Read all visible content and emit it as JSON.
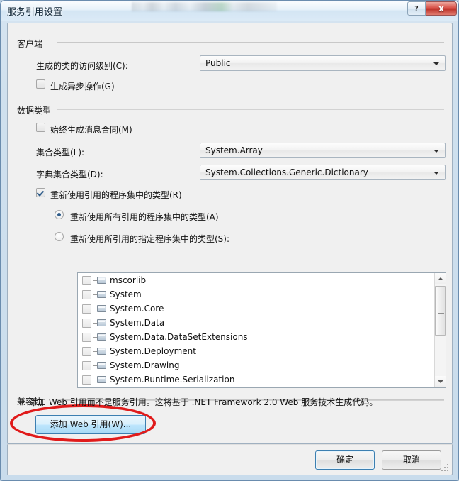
{
  "window": {
    "title": "服务引用设置",
    "help_button": "?",
    "close_button": "x"
  },
  "client_group": {
    "legend": "客户端",
    "access_level_label": "生成的类的访问级别(C):",
    "access_level_value": "Public",
    "async_checkbox_label": "生成异步操作(G)",
    "async_checked": false
  },
  "data_type_group": {
    "legend": "数据类型",
    "message_contract_label": "始终生成消息合同(M)",
    "message_contract_checked": false,
    "collection_type_label": "集合类型(L):",
    "collection_type_value": "System.Array",
    "dictionary_type_label": "字典集合类型(D):",
    "dictionary_type_value": "System.Collections.Generic.Dictionary",
    "reuse_checkbox_label": "重新使用引用的程序集中的类型(R)",
    "reuse_checked": true,
    "reuse_all_radio_label": "重新使用所有引用的程序集中的类型(A)",
    "reuse_all_selected": true,
    "reuse_specified_radio_label": "重新使用所引用的指定程序集中的类型(S):",
    "reuse_specified_selected": false,
    "assemblies": [
      {
        "name": "mscorlib",
        "checked": false
      },
      {
        "name": "System",
        "checked": false
      },
      {
        "name": "System.Core",
        "checked": false
      },
      {
        "name": "System.Data",
        "checked": false
      },
      {
        "name": "System.Data.DataSetExtensions",
        "checked": false
      },
      {
        "name": "System.Deployment",
        "checked": false
      },
      {
        "name": "System.Drawing",
        "checked": false
      },
      {
        "name": "System.Runtime.Serialization",
        "checked": false
      }
    ]
  },
  "compatibility_group": {
    "legend": "兼容性",
    "description": "添加 Web 引用而不是服务引用。这将基于 .NET Framework 2.0 Web 服务技术生成代码。",
    "add_web_reference_button": "添加 Web 引用(W)..."
  },
  "footer": {
    "ok_button": "确定",
    "cancel_button": "取消"
  },
  "colors": {
    "annotation_red": "#e01b1b",
    "accent_blue": "#3c7fb1",
    "close_red": "#bb2f27"
  }
}
